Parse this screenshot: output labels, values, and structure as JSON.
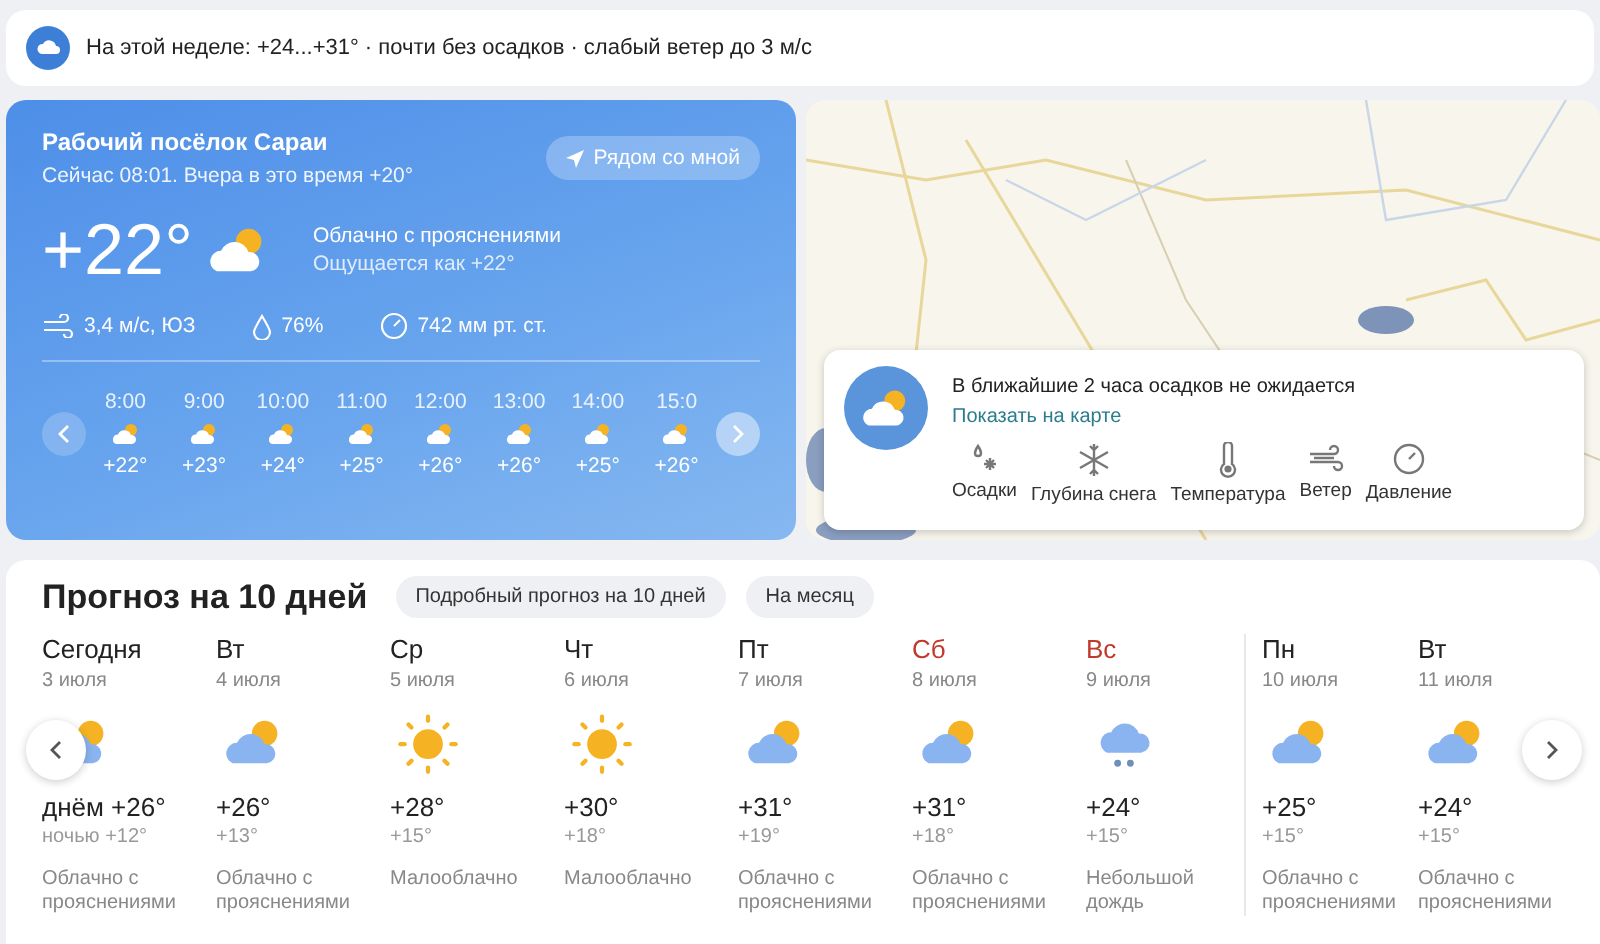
{
  "week_banner": {
    "text": "На этой неделе: +24...+31° · почти без осадков · слабый ветер до 3 м/с"
  },
  "current": {
    "place": "Рабочий посёлок Сараи",
    "subtitle": "Сейчас 08:01. Вчера в это время +20°",
    "nearby_button": "Рядом со мной",
    "temperature": "+22°",
    "kind": "partly_cloudy",
    "condition": "Облачно с прояснениями",
    "feels_like": "Ощущается как +22°",
    "wind": "3,4 м/с, ЮЗ",
    "humidity": "76%",
    "pressure": "742 мм рт. ст.",
    "hours": [
      {
        "time": "8:00",
        "temp": "+22°"
      },
      {
        "time": "9:00",
        "temp": "+23°"
      },
      {
        "time": "10:00",
        "temp": "+24°"
      },
      {
        "time": "11:00",
        "temp": "+25°"
      },
      {
        "time": "12:00",
        "temp": "+26°"
      },
      {
        "time": "13:00",
        "temp": "+26°"
      },
      {
        "time": "14:00",
        "temp": "+25°"
      },
      {
        "time": "15:0",
        "temp": "+26°"
      }
    ]
  },
  "map": {
    "kind": "picture",
    "nowcast": {
      "message": "В ближайшие 2 часа осадков не ожидается",
      "link": "Показать на карте",
      "layers": [
        {
          "kind": "precip",
          "label": "Осадки"
        },
        {
          "kind": "snow",
          "label": "Глубина снега"
        },
        {
          "kind": "temp",
          "label": "Температура"
        },
        {
          "kind": "wind",
          "label": "Ветер"
        },
        {
          "kind": "pressure",
          "label": "Давление"
        }
      ]
    }
  },
  "forecast": {
    "title": "Прогноз на 10 дней",
    "links": [
      "Подробный прогноз на 10 дней",
      "На месяц"
    ],
    "days": [
      {
        "day": "Сегодня",
        "date": "3 июля",
        "kind": "partly_cloudy",
        "day_temp": "днём +26°",
        "night_temp": "ночью +12°",
        "condition": "Облачно с прояснениями",
        "weekend": false
      },
      {
        "day": "Вт",
        "date": "4 июля",
        "kind": "partly_cloudy",
        "day_temp": "+26°",
        "night_temp": "+13°",
        "condition": "Облачно с прояснениями",
        "weekend": false
      },
      {
        "day": "Ср",
        "date": "5 июля",
        "kind": "sunny",
        "day_temp": "+28°",
        "night_temp": "+15°",
        "condition": "Малооблачно",
        "weekend": false
      },
      {
        "day": "Чт",
        "date": "6 июля",
        "kind": "sunny",
        "day_temp": "+30°",
        "night_temp": "+18°",
        "condition": "Малооблачно",
        "weekend": false
      },
      {
        "day": "Пт",
        "date": "7 июля",
        "kind": "partly_cloudy",
        "day_temp": "+31°",
        "night_temp": "+19°",
        "condition": "Облачно с прояснениями",
        "weekend": false
      },
      {
        "day": "Сб",
        "date": "8 июля",
        "kind": "partly_cloudy",
        "day_temp": "+31°",
        "night_temp": "+18°",
        "condition": "Облачно с прояснениями",
        "weekend": true
      },
      {
        "day": "Вс",
        "date": "9 июля",
        "kind": "rain",
        "day_temp": "+24°",
        "night_temp": "+15°",
        "condition": "Небольшой дождь",
        "weekend": true
      },
      {
        "day": "Пн",
        "date": "10 июля",
        "kind": "partly_cloudy",
        "day_temp": "+25°",
        "night_temp": "+15°",
        "condition": "Облачно с прояснениями",
        "weekend": false
      },
      {
        "day": "Вт",
        "date": "11 июля",
        "kind": "partly_cloudy",
        "day_temp": "+24°",
        "night_temp": "+15°",
        "condition": "Облачно с прояснениями",
        "weekend": false
      }
    ]
  }
}
